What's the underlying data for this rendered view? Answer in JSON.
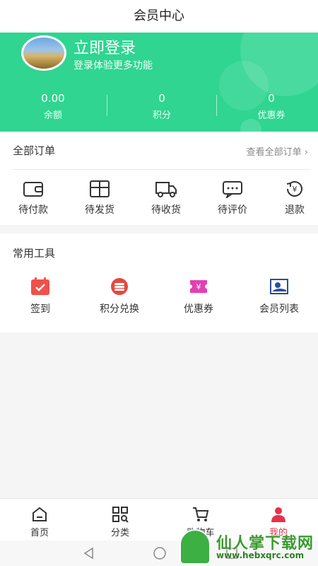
{
  "header": {
    "title": "会员中心"
  },
  "profile": {
    "login_title": "立即登录",
    "login_sub": "登录体验更多功能"
  },
  "stats": [
    {
      "value": "0.00",
      "label": "余额"
    },
    {
      "value": "0",
      "label": "积分"
    },
    {
      "value": "0",
      "label": "优惠券"
    }
  ],
  "orders": {
    "title": "全部订单",
    "more": "查看全部订单 ›",
    "items": [
      {
        "label": "待付款",
        "icon": "wallet-icon"
      },
      {
        "label": "待发货",
        "icon": "package-icon"
      },
      {
        "label": "待收货",
        "icon": "truck-icon"
      },
      {
        "label": "待评价",
        "icon": "comment-icon"
      },
      {
        "label": "退款",
        "icon": "refund-icon"
      }
    ]
  },
  "tools": {
    "title": "常用工具",
    "items": [
      {
        "label": "签到",
        "icon": "calendar-icon",
        "color": "#f0504a"
      },
      {
        "label": "积分兑换",
        "icon": "coins-icon",
        "color": "#e8463f"
      },
      {
        "label": "优惠券",
        "icon": "coupon-icon",
        "color": "#e43fb3"
      },
      {
        "label": "会员列表",
        "icon": "member-card-icon",
        "color": "#2a4f9c"
      }
    ]
  },
  "tabbar": [
    {
      "label": "首页",
      "icon": "home-icon"
    },
    {
      "label": "分类",
      "icon": "category-icon"
    },
    {
      "label": "购物车",
      "icon": "cart-icon"
    },
    {
      "label": "我的",
      "icon": "user-icon",
      "active": true
    }
  ],
  "watermark": {
    "text": "仙人掌下载网",
    "url": "www.hebxqrc.com"
  },
  "colors": {
    "brand": "#2fd591",
    "active": "#e8304a"
  }
}
